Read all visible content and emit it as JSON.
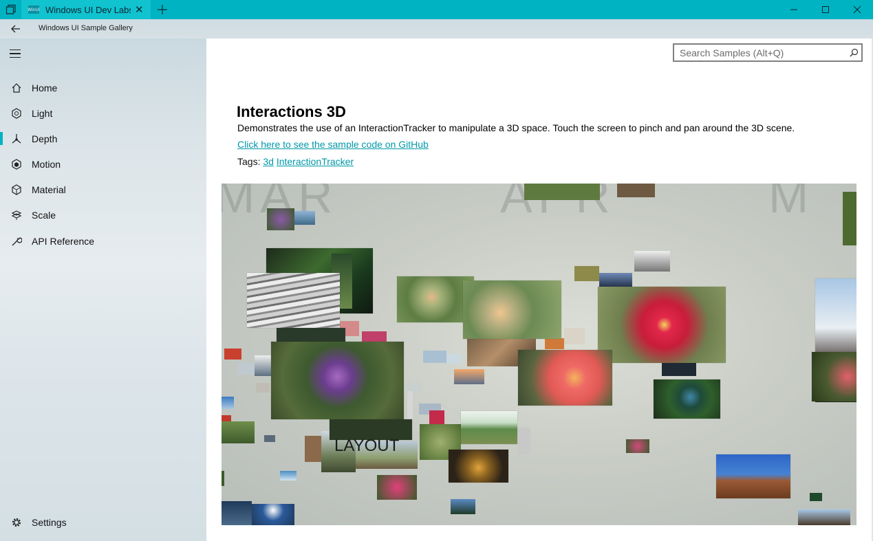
{
  "window": {
    "tab_title": "Windows UI Dev Labs Sample Gallery",
    "tab_favicon_text": "WinUI",
    "colors": {
      "accent": "#00b3c2",
      "link": "#0098a8"
    }
  },
  "app": {
    "title": "Windows UI Sample Gallery"
  },
  "nav": {
    "items": [
      {
        "label": "Home",
        "icon": "home-icon"
      },
      {
        "label": "Light",
        "icon": "light-icon"
      },
      {
        "label": "Depth",
        "icon": "depth-icon",
        "selected": true
      },
      {
        "label": "Motion",
        "icon": "motion-icon"
      },
      {
        "label": "Material",
        "icon": "material-icon"
      },
      {
        "label": "Scale",
        "icon": "scale-icon"
      },
      {
        "label": "API Reference",
        "icon": "wrench-icon"
      }
    ],
    "settings_label": "Settings"
  },
  "search": {
    "placeholder": "Search Samples (Alt+Q)"
  },
  "page": {
    "title": "Interactions 3D",
    "description": "Demonstrates the use of an InteractionTracker to manipulate a 3D space.  Touch the screen to pinch and pan around the 3D scene.",
    "github_link": "Click here to see the sample code on GitHub",
    "tags_label": "Tags:",
    "tags": [
      "3d",
      "InteractionTracker"
    ]
  },
  "scene": {
    "ghost_words": [
      "MAR",
      "APR",
      "M"
    ],
    "layout_word": "LAYOUT"
  }
}
